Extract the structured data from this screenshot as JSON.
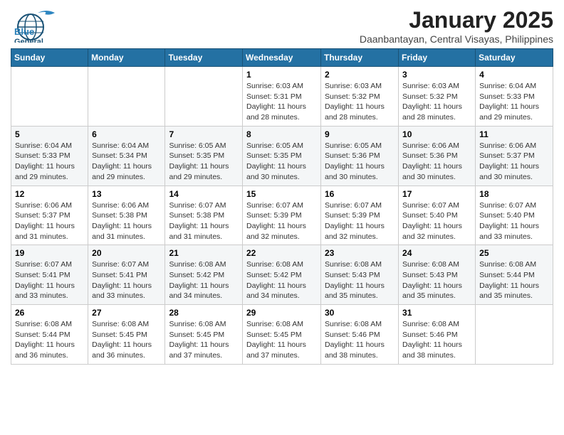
{
  "header": {
    "logo_general": "General",
    "logo_blue": "Blue",
    "main_title": "January 2025",
    "subtitle": "Daanbantayan, Central Visayas, Philippines"
  },
  "days_of_week": [
    "Sunday",
    "Monday",
    "Tuesday",
    "Wednesday",
    "Thursday",
    "Friday",
    "Saturday"
  ],
  "weeks": [
    [
      {
        "day": "",
        "sunrise": "",
        "sunset": "",
        "daylight": ""
      },
      {
        "day": "",
        "sunrise": "",
        "sunset": "",
        "daylight": ""
      },
      {
        "day": "",
        "sunrise": "",
        "sunset": "",
        "daylight": ""
      },
      {
        "day": "1",
        "sunrise": "Sunrise: 6:03 AM",
        "sunset": "Sunset: 5:31 PM",
        "daylight": "Daylight: 11 hours and 28 minutes."
      },
      {
        "day": "2",
        "sunrise": "Sunrise: 6:03 AM",
        "sunset": "Sunset: 5:32 PM",
        "daylight": "Daylight: 11 hours and 28 minutes."
      },
      {
        "day": "3",
        "sunrise": "Sunrise: 6:03 AM",
        "sunset": "Sunset: 5:32 PM",
        "daylight": "Daylight: 11 hours and 28 minutes."
      },
      {
        "day": "4",
        "sunrise": "Sunrise: 6:04 AM",
        "sunset": "Sunset: 5:33 PM",
        "daylight": "Daylight: 11 hours and 29 minutes."
      }
    ],
    [
      {
        "day": "5",
        "sunrise": "Sunrise: 6:04 AM",
        "sunset": "Sunset: 5:33 PM",
        "daylight": "Daylight: 11 hours and 29 minutes."
      },
      {
        "day": "6",
        "sunrise": "Sunrise: 6:04 AM",
        "sunset": "Sunset: 5:34 PM",
        "daylight": "Daylight: 11 hours and 29 minutes."
      },
      {
        "day": "7",
        "sunrise": "Sunrise: 6:05 AM",
        "sunset": "Sunset: 5:35 PM",
        "daylight": "Daylight: 11 hours and 29 minutes."
      },
      {
        "day": "8",
        "sunrise": "Sunrise: 6:05 AM",
        "sunset": "Sunset: 5:35 PM",
        "daylight": "Daylight: 11 hours and 30 minutes."
      },
      {
        "day": "9",
        "sunrise": "Sunrise: 6:05 AM",
        "sunset": "Sunset: 5:36 PM",
        "daylight": "Daylight: 11 hours and 30 minutes."
      },
      {
        "day": "10",
        "sunrise": "Sunrise: 6:06 AM",
        "sunset": "Sunset: 5:36 PM",
        "daylight": "Daylight: 11 hours and 30 minutes."
      },
      {
        "day": "11",
        "sunrise": "Sunrise: 6:06 AM",
        "sunset": "Sunset: 5:37 PM",
        "daylight": "Daylight: 11 hours and 30 minutes."
      }
    ],
    [
      {
        "day": "12",
        "sunrise": "Sunrise: 6:06 AM",
        "sunset": "Sunset: 5:37 PM",
        "daylight": "Daylight: 11 hours and 31 minutes."
      },
      {
        "day": "13",
        "sunrise": "Sunrise: 6:06 AM",
        "sunset": "Sunset: 5:38 PM",
        "daylight": "Daylight: 11 hours and 31 minutes."
      },
      {
        "day": "14",
        "sunrise": "Sunrise: 6:07 AM",
        "sunset": "Sunset: 5:38 PM",
        "daylight": "Daylight: 11 hours and 31 minutes."
      },
      {
        "day": "15",
        "sunrise": "Sunrise: 6:07 AM",
        "sunset": "Sunset: 5:39 PM",
        "daylight": "Daylight: 11 hours and 32 minutes."
      },
      {
        "day": "16",
        "sunrise": "Sunrise: 6:07 AM",
        "sunset": "Sunset: 5:39 PM",
        "daylight": "Daylight: 11 hours and 32 minutes."
      },
      {
        "day": "17",
        "sunrise": "Sunrise: 6:07 AM",
        "sunset": "Sunset: 5:40 PM",
        "daylight": "Daylight: 11 hours and 32 minutes."
      },
      {
        "day": "18",
        "sunrise": "Sunrise: 6:07 AM",
        "sunset": "Sunset: 5:40 PM",
        "daylight": "Daylight: 11 hours and 33 minutes."
      }
    ],
    [
      {
        "day": "19",
        "sunrise": "Sunrise: 6:07 AM",
        "sunset": "Sunset: 5:41 PM",
        "daylight": "Daylight: 11 hours and 33 minutes."
      },
      {
        "day": "20",
        "sunrise": "Sunrise: 6:07 AM",
        "sunset": "Sunset: 5:41 PM",
        "daylight": "Daylight: 11 hours and 33 minutes."
      },
      {
        "day": "21",
        "sunrise": "Sunrise: 6:08 AM",
        "sunset": "Sunset: 5:42 PM",
        "daylight": "Daylight: 11 hours and 34 minutes."
      },
      {
        "day": "22",
        "sunrise": "Sunrise: 6:08 AM",
        "sunset": "Sunset: 5:42 PM",
        "daylight": "Daylight: 11 hours and 34 minutes."
      },
      {
        "day": "23",
        "sunrise": "Sunrise: 6:08 AM",
        "sunset": "Sunset: 5:43 PM",
        "daylight": "Daylight: 11 hours and 35 minutes."
      },
      {
        "day": "24",
        "sunrise": "Sunrise: 6:08 AM",
        "sunset": "Sunset: 5:43 PM",
        "daylight": "Daylight: 11 hours and 35 minutes."
      },
      {
        "day": "25",
        "sunrise": "Sunrise: 6:08 AM",
        "sunset": "Sunset: 5:44 PM",
        "daylight": "Daylight: 11 hours and 35 minutes."
      }
    ],
    [
      {
        "day": "26",
        "sunrise": "Sunrise: 6:08 AM",
        "sunset": "Sunset: 5:44 PM",
        "daylight": "Daylight: 11 hours and 36 minutes."
      },
      {
        "day": "27",
        "sunrise": "Sunrise: 6:08 AM",
        "sunset": "Sunset: 5:45 PM",
        "daylight": "Daylight: 11 hours and 36 minutes."
      },
      {
        "day": "28",
        "sunrise": "Sunrise: 6:08 AM",
        "sunset": "Sunset: 5:45 PM",
        "daylight": "Daylight: 11 hours and 37 minutes."
      },
      {
        "day": "29",
        "sunrise": "Sunrise: 6:08 AM",
        "sunset": "Sunset: 5:45 PM",
        "daylight": "Daylight: 11 hours and 37 minutes."
      },
      {
        "day": "30",
        "sunrise": "Sunrise: 6:08 AM",
        "sunset": "Sunset: 5:46 PM",
        "daylight": "Daylight: 11 hours and 38 minutes."
      },
      {
        "day": "31",
        "sunrise": "Sunrise: 6:08 AM",
        "sunset": "Sunset: 5:46 PM",
        "daylight": "Daylight: 11 hours and 38 minutes."
      },
      {
        "day": "",
        "sunrise": "",
        "sunset": "",
        "daylight": ""
      }
    ]
  ]
}
